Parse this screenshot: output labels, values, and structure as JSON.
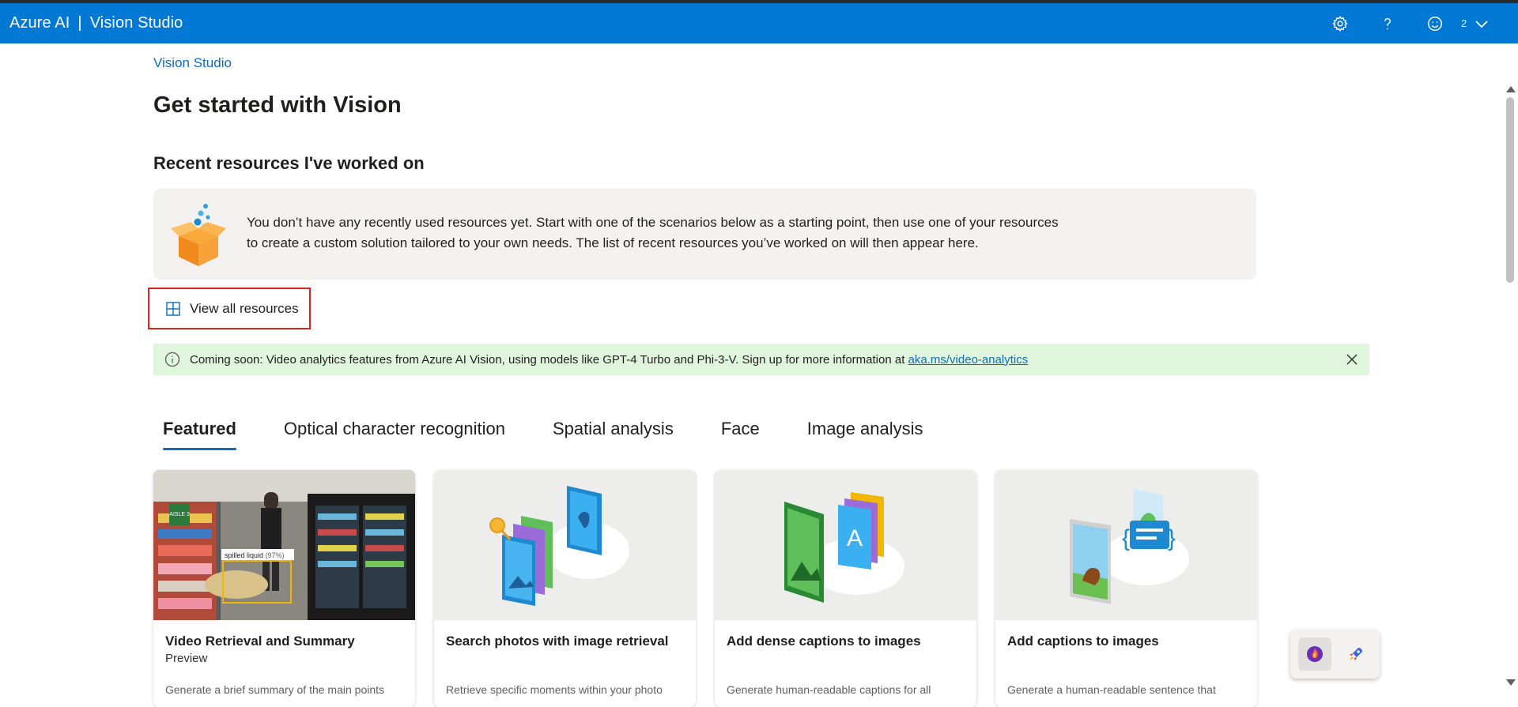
{
  "header": {
    "brand_left": "Azure AI",
    "brand_sep": "|",
    "brand_right": "Vision Studio",
    "account_badge": "2",
    "icons": [
      "settings-icon",
      "help-icon",
      "feedback-smiley-icon",
      "chevron-down-icon"
    ]
  },
  "breadcrumb": "Vision Studio",
  "page_title": "Get started with Vision",
  "recent": {
    "title": "Recent resources I've worked on",
    "empty_line1": "You don’t have any recently used resources yet. Start with one of the scenarios below as a starting point, then use one of your resources",
    "empty_line2": "to create a custom solution tailored to your own needs. The list of recent resources you’ve worked on will then appear here.",
    "view_all_label": "View all resources"
  },
  "banner": {
    "text": "Coming soon: Video analytics features from Azure AI Vision, using models like GPT-4 Turbo and Phi-3-V. Sign up for more information at ",
    "link": "aka.ms/video-analytics"
  },
  "tabs": [
    {
      "label": "Featured",
      "active": true
    },
    {
      "label": "Optical character recognition",
      "active": false
    },
    {
      "label": "Spatial analysis",
      "active": false
    },
    {
      "label": "Face",
      "active": false
    },
    {
      "label": "Image analysis",
      "active": false
    }
  ],
  "cards": [
    {
      "title": "Video Retrieval and Summary",
      "subtitle": "Preview",
      "desc": "Generate a brief summary of the main points",
      "overlay_label": "spilled liquid",
      "overlay_conf": "(97%)",
      "aisle": "AISLE 3"
    },
    {
      "title": "Search photos with image retrieval",
      "subtitle": "",
      "desc": "Retrieve specific moments within your photo"
    },
    {
      "title": "Add dense captions to images",
      "subtitle": "",
      "desc": "Generate human-readable captions for all"
    },
    {
      "title": "Add captions to images",
      "subtitle": "",
      "desc": "Generate a human-readable sentence that"
    }
  ],
  "colors": {
    "header_bg": "#0078d4",
    "link": "#0f6cbd",
    "banner_bg": "#dff6dd",
    "highlight_border": "#e0201b",
    "card_empty_bg": "#f3f2f1"
  }
}
